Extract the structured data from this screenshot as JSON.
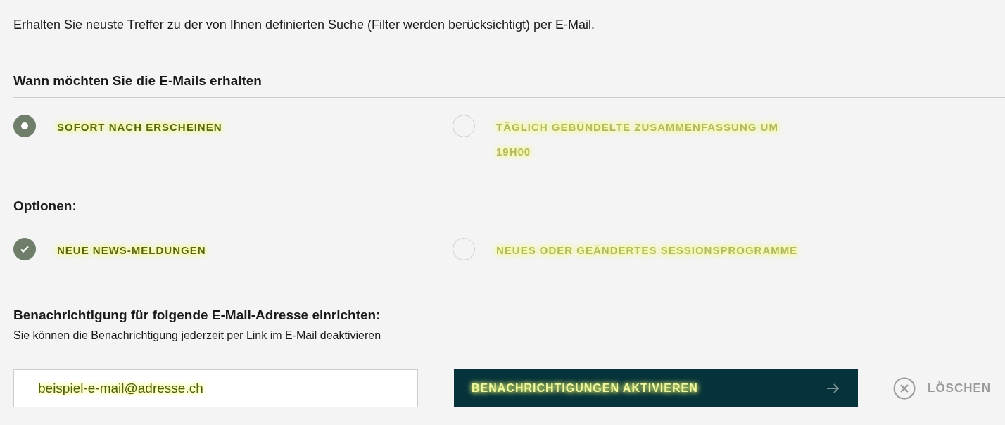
{
  "intro": "Erhalten Sie neuste Treffer zu der von Ihnen definierten Suche (Filter werden berücksichtigt) per E-Mail.",
  "frequency": {
    "heading": "Wann möchten Sie die E-Mails erhalten",
    "options": [
      {
        "label": "SOFORT NACH ERSCHEINEN",
        "selected": true
      },
      {
        "label": "TÄGLICH GEBÜNDELTE ZUSAMMENFASSUNG UM 19H00",
        "selected": false
      }
    ]
  },
  "options": {
    "heading": "Optionen:",
    "items": [
      {
        "label": "NEUE NEWS-MELDUNGEN",
        "checked": true
      },
      {
        "label": "NEUES ODER GEÄNDERTES SESSIONSPROGRAMME",
        "checked": false
      }
    ]
  },
  "email": {
    "heading": "Benachrichtigung für folgende E-Mail-Adresse einrichten:",
    "hint": "Sie können die Benachrichtigung jederzeit per Link im E-Mail deaktivieren",
    "value": "beispiel-e-mail@adresse.ch"
  },
  "activate_button": "BENACHRICHTIGUNGEN AKTIVIEREN",
  "delete_button": "LÖSCHEN"
}
